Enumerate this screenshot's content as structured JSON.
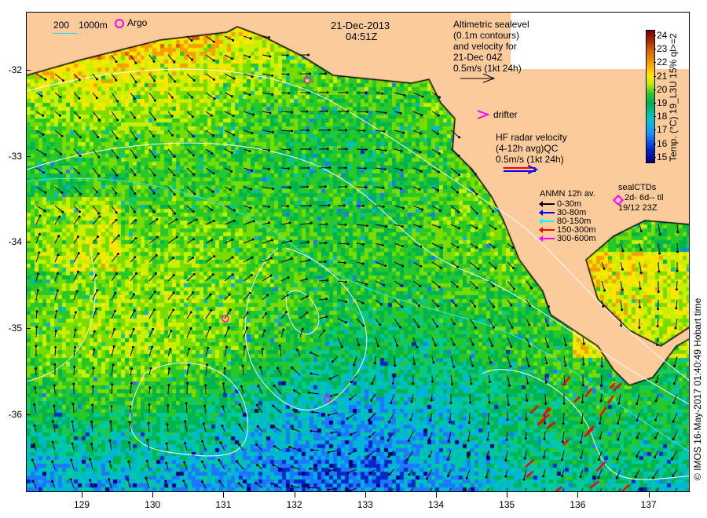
{
  "header": {
    "date": "21-Dec-2013",
    "time": "04:51Z"
  },
  "bathy_legend": {
    "c200": "200",
    "c1000": "1000m"
  },
  "argo_label": "Argo",
  "altimetry": {
    "lines": [
      "Altimetric sealevel",
      "(0.1m contours)",
      "and velocity for",
      "21-Dec 04Z",
      "0.5m/s (1kt 24h)"
    ]
  },
  "drifter_label": "drifter",
  "hf_radar": {
    "lines": [
      "HF radar velocity",
      "(4-12h avg)QC",
      "0.5m/s (1kt 24h)"
    ]
  },
  "anmn": {
    "title": "ANMN 12h av.",
    "items": [
      {
        "label": "0-30m",
        "color": "#000000"
      },
      {
        "label": "30-80m",
        "color": "#0000ff"
      },
      {
        "label": "80-150m",
        "color": "#00ffff"
      },
      {
        "label": "150-300m",
        "color": "#ff0000"
      },
      {
        "label": "300-600m",
        "color": "#ff00ff"
      }
    ]
  },
  "sealctd": {
    "title": "sealCTDs",
    "line1": "2d- 6d-- til",
    "line2": "19/12 23Z"
  },
  "colorbar": {
    "label": "Temp. (°C) 19_L3U 15% ql>=2",
    "ticks": [
      "24",
      "23",
      "22",
      "21",
      "20",
      "19",
      "18",
      "17",
      "16",
      "15"
    ]
  },
  "y_axis": {
    "ticks": [
      "-32",
      "-33",
      "-34",
      "-35",
      "-36"
    ]
  },
  "x_axis": {
    "ticks": [
      "129",
      "130",
      "131",
      "132",
      "133",
      "134",
      "135",
      "136",
      "137"
    ]
  },
  "credit": "© IMOS 16-May-2017 01:40:49 Hobart time",
  "colors": {
    "land": "#fccb9b",
    "argo": "#ff00ff"
  }
}
